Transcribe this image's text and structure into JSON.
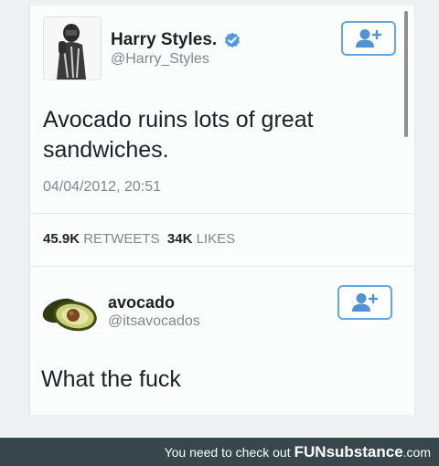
{
  "tweet1": {
    "name": "Harry Styles.",
    "handle": "@Harry_Styles",
    "text": "Avocado ruins lots of great sandwiches.",
    "timestamp": "04/04/2012, 20:51",
    "retweets_count": "45.9K",
    "retweets_label": "RETWEETS",
    "likes_count": "34K",
    "likes_label": "LIKES",
    "verified_icon": "verified-badge-icon",
    "follow_icon": "add-user-icon"
  },
  "tweet2": {
    "name": "avocado",
    "handle": "@itsavocados",
    "text": "What the fuck",
    "follow_icon": "add-user-icon"
  },
  "footer": {
    "prefix": "You need to check out",
    "brand_fun": "FUN",
    "brand_rest": "substance",
    "domain": ".com"
  },
  "colors": {
    "accent": "#64a6dd",
    "footer_bg": "#37474c"
  }
}
